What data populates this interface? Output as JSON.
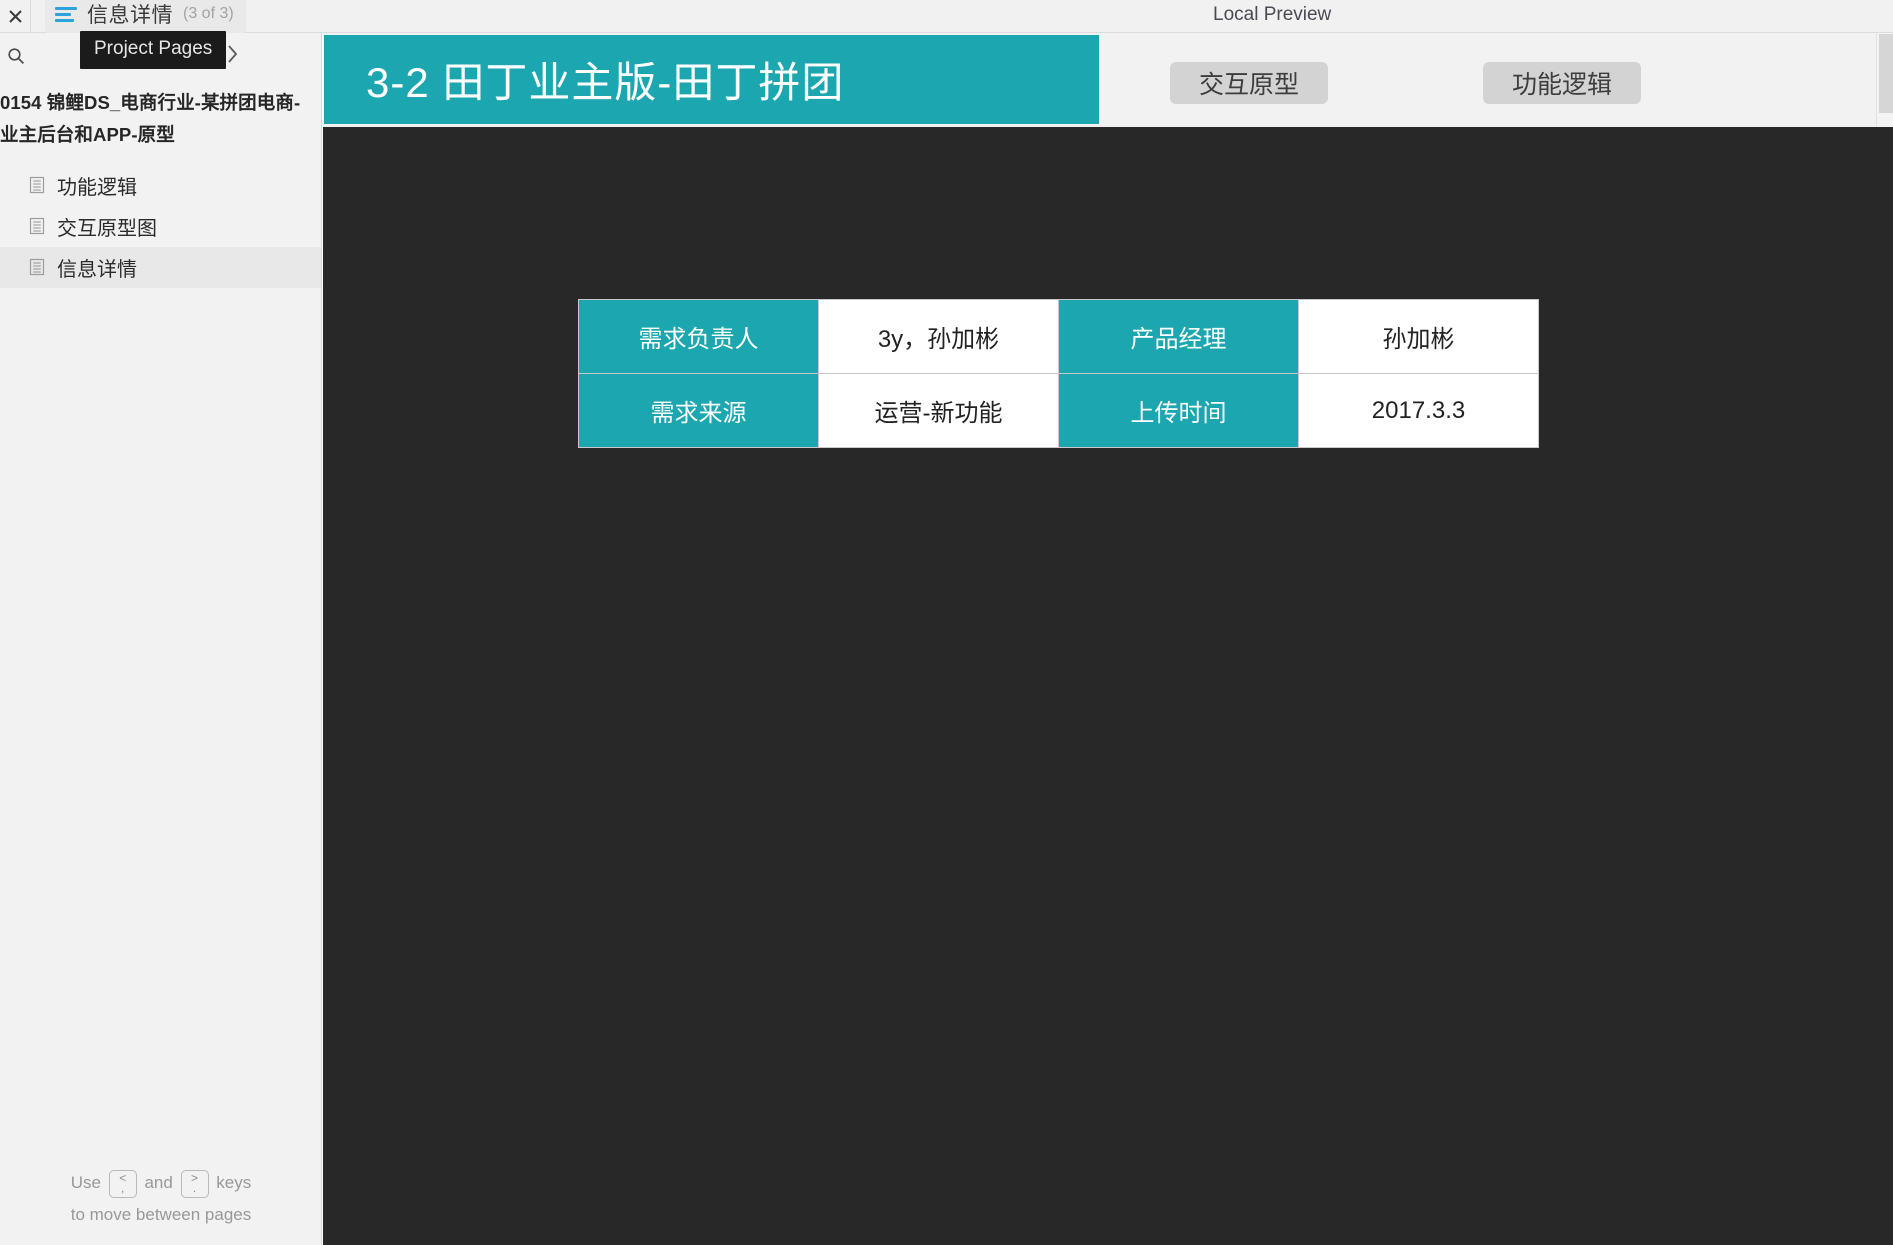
{
  "topbar": {
    "close_icon": "close-icon",
    "menu_icon": "hamburger-icon",
    "tab_title": "信息详情",
    "tab_counter": "(3 of 3)",
    "preview_label": "Local Preview"
  },
  "tooltip": {
    "text": "Project Pages"
  },
  "sidebar": {
    "search_icon": "search-icon",
    "prev_arrow": "chevron-left-icon",
    "next_arrow": "chevron-right-icon",
    "project_title": "0154 锦鲤DS_电商行业-某拼团电商-业主后台和APP-原型",
    "pages": [
      {
        "label": "功能逻辑",
        "icon": "document-icon",
        "selected": false
      },
      {
        "label": "交互原型图",
        "icon": "document-icon",
        "selected": false
      },
      {
        "label": "信息详情",
        "icon": "document-icon",
        "selected": true
      }
    ],
    "footer": {
      "use_word": "Use",
      "key_prev_top": "<",
      "key_prev_bottom": ",",
      "and_word": "and",
      "key_next_top": ">",
      "key_next_bottom": ".",
      "keys_word": "keys",
      "line2": "to move between pages"
    }
  },
  "content": {
    "banner_title": "3-2  田丁业主版-田丁拼团",
    "pill_interactive": "交互原型",
    "pill_logic": "功能逻辑"
  },
  "info_table": {
    "rows": [
      {
        "label1": "需求负责人",
        "value1": "3y，孙加彬",
        "label2": "产品经理",
        "value2": "孙加彬"
      },
      {
        "label1": "需求来源",
        "value1": "运营-新功能",
        "label2": "上传时间",
        "value2": "2017.3.3"
      }
    ]
  },
  "colors": {
    "teal": "#1ca6b0",
    "dark_canvas": "#282828",
    "sidebar_bg": "#f2f2f2",
    "pill_bg": "#d3d3d3",
    "accent_blue": "#29a3dc"
  }
}
